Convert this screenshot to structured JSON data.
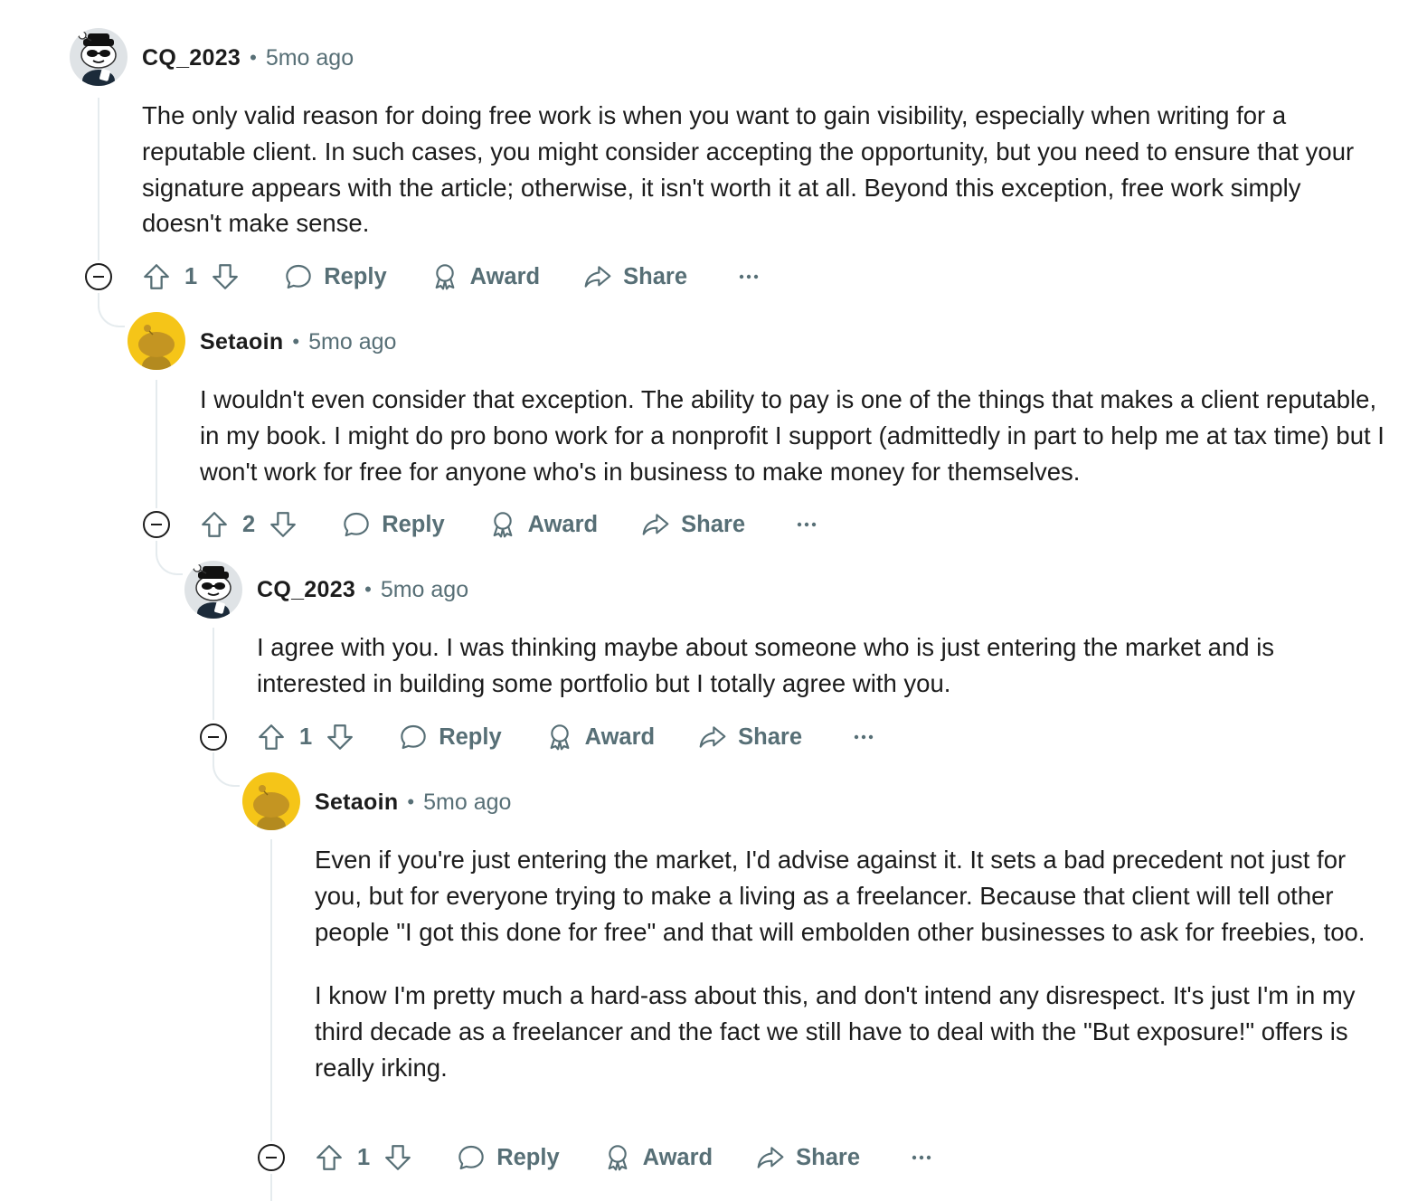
{
  "comments": [
    {
      "author": "CQ_2023",
      "time": "5mo ago",
      "avatar": "snoo-sunglasses-avatar",
      "paragraphs": [
        "The only valid reason for doing free work is when you want to gain visibility, especially when writing for a reputable client. In such cases, you might consider accepting the opportunity, but you need to ensure that your signature appears with the article; otherwise, it isn't worth it at all. Beyond this exception, free work simply doesn't make sense."
      ],
      "score": "1",
      "reply_label": "Reply",
      "award_label": "Award",
      "share_label": "Share"
    },
    {
      "author": "Setaoin",
      "time": "5mo ago",
      "avatar": "snoo-yellow-avatar",
      "paragraphs": [
        "I wouldn't even consider that exception. The ability to pay is one of the things that makes a client reputable, in my book. I might do pro bono work for a nonprofit I support (admittedly in part to help me at tax time) but I won't work for free for anyone who's in business to make money for themselves."
      ],
      "score": "2",
      "reply_label": "Reply",
      "award_label": "Award",
      "share_label": "Share"
    },
    {
      "author": "CQ_2023",
      "time": "5mo ago",
      "avatar": "snoo-sunglasses-avatar",
      "paragraphs": [
        "I agree with you. I was thinking maybe about someone who is just entering the market and is interested in building some portfolio but I totally agree with you."
      ],
      "score": "1",
      "reply_label": "Reply",
      "award_label": "Award",
      "share_label": "Share"
    },
    {
      "author": "Setaoin",
      "time": "5mo ago",
      "avatar": "snoo-yellow-avatar",
      "paragraphs": [
        "Even if you're just entering the market, I'd advise against it. It sets a bad precedent not just for you, but for everyone trying to make a living as a freelancer. Because that client will tell other people \"I got this done for free\" and that will embolden other businesses to ask for freebies, too.",
        "I know I'm pretty much a hard-ass about this, and don't intend any disrespect. It's just I'm in my third decade as a freelancer and the fact we still have to deal with the \"But exposure!\" offers is really irking."
      ],
      "score": "1",
      "reply_label": "Reply",
      "award_label": "Award",
      "share_label": "Share"
    }
  ],
  "icons": {
    "collapse": "minus-circle-icon",
    "upvote": "upvote-arrow-icon",
    "downvote": "downvote-arrow-icon",
    "reply": "speech-bubble-icon",
    "award": "award-ribbon-icon",
    "share": "share-arrow-icon",
    "more": "ellipsis-icon"
  },
  "colors": {
    "meta_gray": "#576f76",
    "text": "#1c1c1c",
    "thread_line": "#e5ebee",
    "yellow_avatar": "#f5c518"
  }
}
